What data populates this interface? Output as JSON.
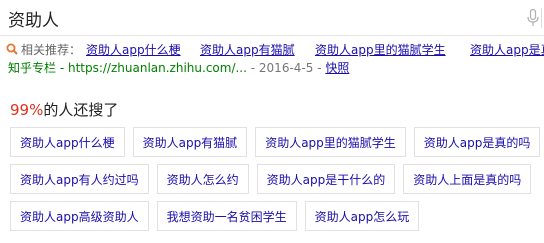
{
  "search": {
    "query": "资助人"
  },
  "suggestions": {
    "label": "相关推荐：",
    "items": [
      "资助人app什么梗",
      "资助人app有猫腻",
      "资助人app里的猫腻学生",
      "资助人app是真"
    ]
  },
  "partial_result": {
    "source": "知乎专栏 - https://zhuanlan.zhihu.com/...",
    "date": "- 2016-4-5 -",
    "snapshot": "快照"
  },
  "also_searched": {
    "percent": "99%",
    "text": "的人还搜了",
    "rows": [
      [
        "资助人app什么梗",
        "资助人app有猫腻",
        "资助人app里的猫腻学生",
        "资助人app是真的吗"
      ],
      [
        "资助人app有人约过吗",
        "资助人怎么约",
        "资助人app是干什么的",
        "资助人上面是真的吗"
      ],
      [
        "资助人app高级资助人",
        "我想资助一名贫困学生",
        "资助人app怎么玩"
      ]
    ]
  },
  "colors": {
    "link": "#1a0dab",
    "percent": "#e0301e",
    "source_green": "#008000",
    "icon_orange": "#e8742e"
  },
  "icons": [
    "microphone-icon",
    "search-suggest-icon"
  ]
}
